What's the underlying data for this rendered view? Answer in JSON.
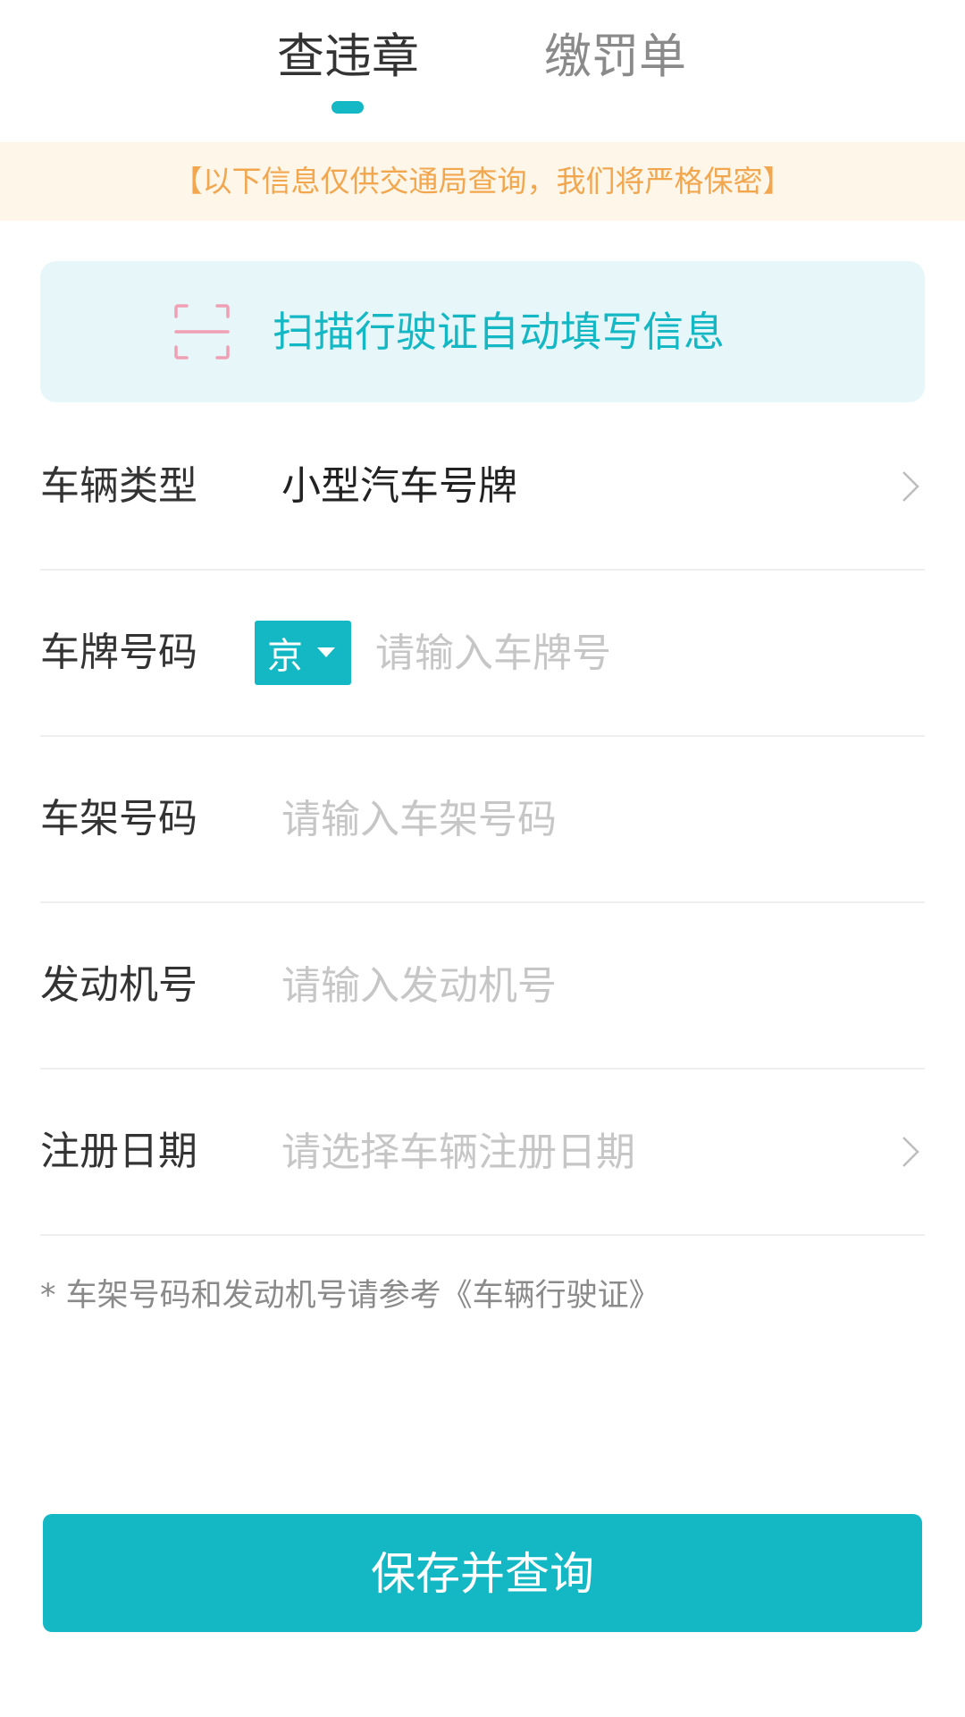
{
  "tabs": [
    {
      "label": "查违章",
      "active": true
    },
    {
      "label": "缴罚单",
      "active": false
    }
  ],
  "notice": "【以下信息仅供交通局查询，我们将严格保密】",
  "scan": {
    "label": "扫描行驶证自动填写信息",
    "icon": "scan-frame-icon"
  },
  "form": {
    "vehicle_type": {
      "label": "车辆类型",
      "value": "小型汽车号牌"
    },
    "plate": {
      "label": "车牌号码",
      "province": "京",
      "placeholder": "请输入车牌号"
    },
    "frame": {
      "label": "车架号码",
      "placeholder": "请输入车架号码"
    },
    "engine": {
      "label": "发动机号",
      "placeholder": "请输入发动机号"
    },
    "register_date": {
      "label": "注册日期",
      "placeholder": "请选择车辆注册日期"
    }
  },
  "footnote": "* 车架号码和发动机号请参考《车辆行驶证》",
  "submit_label": "保存并查询",
  "colors": {
    "accent": "#14b8c4",
    "notice_bg": "#fff6ea",
    "notice_text": "#f2a74f",
    "scan_bg": "#e7f6f8",
    "scan_icon": "#f0a0b4"
  }
}
